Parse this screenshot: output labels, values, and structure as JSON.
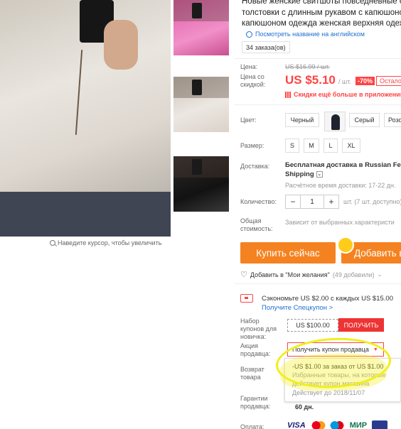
{
  "title_lines": [
    "Новые женские свитшоты повседневные об",
    "толстовки с длинным рукавом с капюшоно",
    "капюшоном одежда женская верхняя одеж"
  ],
  "translate_link": "Посмотреть название на английском",
  "orders": "34 заказа(ов)",
  "price": {
    "label": "Цена:",
    "old": "US $16.99 / шт.",
    "discount_label": "Цена со скидкой:",
    "new": "US $5.10",
    "unit": "/ шт.",
    "discount_badge": "-70%",
    "left_badge": "Остало",
    "app_discount": "Скидки ещё больше в приложении"
  },
  "color": {
    "label": "Цвет:",
    "options": [
      "Черный",
      "Серый",
      "Розо"
    ]
  },
  "size": {
    "label": "Размер:",
    "options": [
      "S",
      "M",
      "L",
      "XL"
    ]
  },
  "shipping": {
    "label": "Доставка:",
    "line1": "Бесплатная доставка в Russian Fede",
    "line2": "Shipping",
    "time": "Расчётное время доставки: 17-22 дн."
  },
  "quantity": {
    "label": "Количество:",
    "minus": "−",
    "value": "1",
    "plus": "+",
    "unit": "шт. (7 шт. доступно)"
  },
  "total": {
    "label": "Общая стоимость:",
    "value": "Зависит от выбранных характеристи"
  },
  "buttons": {
    "buy": "Купить сейчас",
    "cart": "Добавить в"
  },
  "wishlist": {
    "label": "Добавить в \"Мои желания\"",
    "count": "(49 добавили)"
  },
  "savings": {
    "text": "Сэкономьте US $2.00 с каждых US $15.00",
    "link": "Получите Спецкупон >"
  },
  "coupon_set": {
    "label": "Набор купонов для новичка:",
    "value": "US $100.00",
    "button": "ПОЛУЧИТЬ"
  },
  "seller_promo": {
    "label": "Акция продавца:",
    "button": "Получить купон продавца",
    "popup": [
      "-US $1.00 за заказ от US $1.00",
      "Избранные товары, на которые",
      "действует купон магазина",
      "Действует до 2018/11/07"
    ]
  },
  "returns": {
    "label": "Возврат товара"
  },
  "warranty": {
    "label": "Гарантии продавца:",
    "value": "60 дн."
  },
  "payment": {
    "label": "Оплата:",
    "visa": "VISA",
    "mir": "МИР"
  },
  "zoom_hint": "Наведите курсор, чтобы увеличить",
  "colors": {
    "accent": "#f44444",
    "button": "#f58220",
    "link": "#1e6fd0",
    "highlight": "#f1ee1a"
  }
}
